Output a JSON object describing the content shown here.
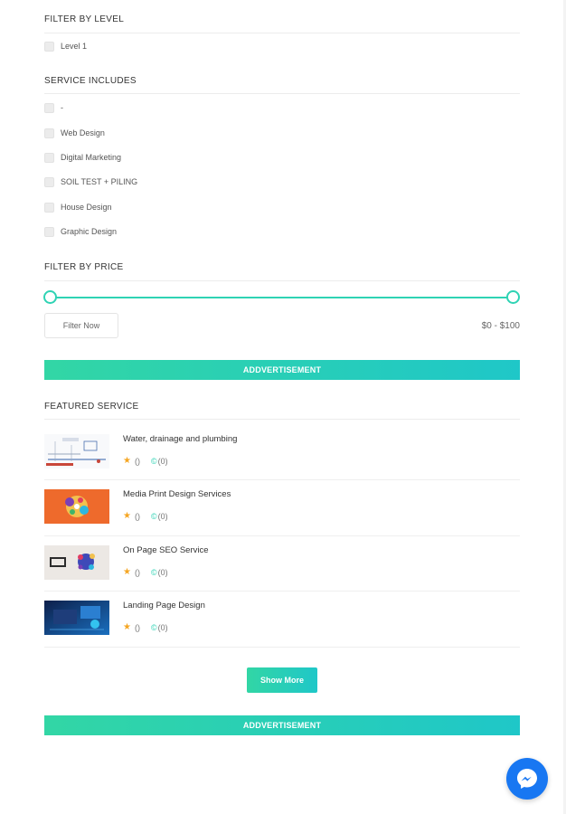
{
  "filter_level": {
    "title": "FILTER BY LEVEL",
    "options": [
      {
        "label": "Level 1"
      }
    ]
  },
  "service_includes": {
    "title": "SERVICE INCLUDES",
    "options": [
      {
        "label": "-"
      },
      {
        "label": "Web Design"
      },
      {
        "label": "Digital Marketing"
      },
      {
        "label": "SOIL TEST + PILING"
      },
      {
        "label": "House Design"
      },
      {
        "label": "Graphic Design"
      }
    ]
  },
  "filter_price": {
    "title": "FILTER BY PRICE",
    "button_label": "Filter Now",
    "range_label": "$0 - $100",
    "accent_color": "#2fd3b4"
  },
  "ads": {
    "top_label": "ADDVERTISEMENT",
    "bottom_label": "ADDVERTISEMENT"
  },
  "featured": {
    "title": "FEATURED SERVICE",
    "items": [
      {
        "title": "Water, drainage and plumbing",
        "rating": "()",
        "orders": "(0)"
      },
      {
        "title": "Media Print Design Services",
        "rating": "()",
        "orders": "(0)"
      },
      {
        "title": "On Page SEO Service",
        "rating": "()",
        "orders": "(0)"
      },
      {
        "title": "Landing Page Design",
        "rating": "()",
        "orders": "(0)"
      }
    ],
    "show_more_label": "Show More"
  },
  "icons": {
    "star": "star-icon",
    "orders": "orders-icon",
    "messenger": "messenger-icon"
  }
}
